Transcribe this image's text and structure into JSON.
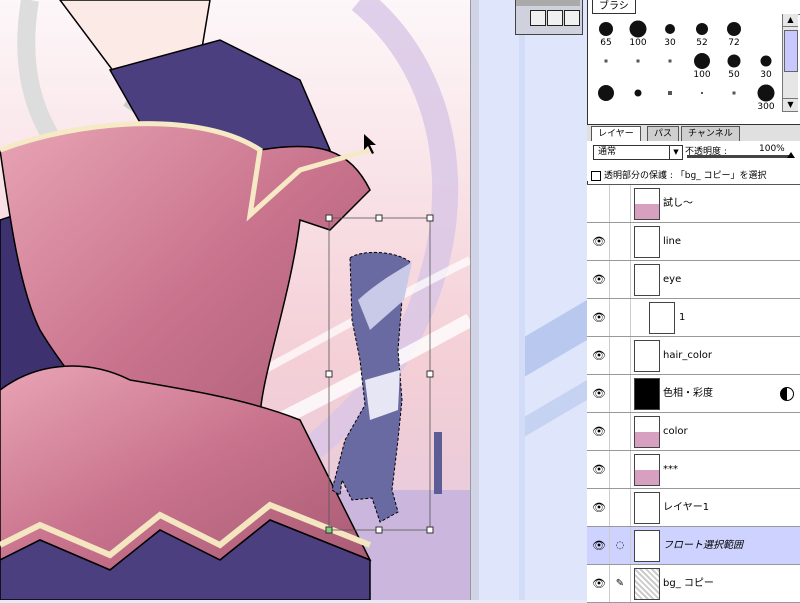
{
  "palettes": {
    "brushes": {
      "tab_label": "ブラシ",
      "brushes": [
        {
          "size": "65",
          "dot": 14
        },
        {
          "size": "100",
          "dot": 17
        },
        {
          "size": "30",
          "dot": 10
        },
        {
          "size": "52",
          "dot": 12
        },
        {
          "size": "72",
          "dot": 14
        },
        {
          "size": "",
          "dot": 0
        },
        {
          "size": "",
          "dot": 3
        },
        {
          "size": "",
          "dot": 3
        },
        {
          "size": "",
          "dot": 3
        },
        {
          "size": "100",
          "dot": 16
        },
        {
          "size": "50",
          "dot": 13
        },
        {
          "size": "30",
          "dot": 11
        },
        {
          "size": "",
          "dot": 16
        },
        {
          "size": "",
          "dot": 7
        },
        {
          "size": "",
          "dot": 4
        },
        {
          "size": "",
          "dot": 2
        },
        {
          "size": "",
          "dot": 3
        },
        {
          "size": "300",
          "dot": 17
        }
      ]
    },
    "layers": {
      "tabs": [
        {
          "label": "レイヤー",
          "active": true
        },
        {
          "label": "パス",
          "active": false
        },
        {
          "label": "チャンネル",
          "active": false
        }
      ],
      "blend_mode": "通常",
      "opacity_label": "不透明度 :",
      "opacity_value": "100%",
      "preserve_label": "透明部分の保護 : 「bg_ コピー」を選択",
      "items": [
        {
          "name": "試し〜",
          "visible": false,
          "selected": false
        },
        {
          "name": "line",
          "visible": true,
          "selected": false
        },
        {
          "name": "eye",
          "visible": true,
          "selected": false
        },
        {
          "name": "1",
          "visible": true,
          "selected": false,
          "indent": true
        },
        {
          "name": "hair_color",
          "visible": true,
          "selected": false
        },
        {
          "name": "色相・彩度",
          "visible": true,
          "selected": false,
          "adjustment": true
        },
        {
          "name": "color",
          "visible": true,
          "selected": false
        },
        {
          "name": "***",
          "visible": true,
          "selected": false
        },
        {
          "name": "レイヤー1",
          "visible": true,
          "selected": false
        },
        {
          "name": "フロート選択範囲",
          "visible": true,
          "selected": true,
          "italic": true
        },
        {
          "name": "bg_ コピー",
          "visible": true,
          "selected": false,
          "brush_link": true
        }
      ]
    }
  },
  "colors": {
    "canvas_sky": "#f7e6ee",
    "dress_pink": "#cf7d95",
    "dress_purple": "#4a3d7a",
    "selected_layer": "#cdd2ff",
    "desk": "#dfe6fb"
  }
}
